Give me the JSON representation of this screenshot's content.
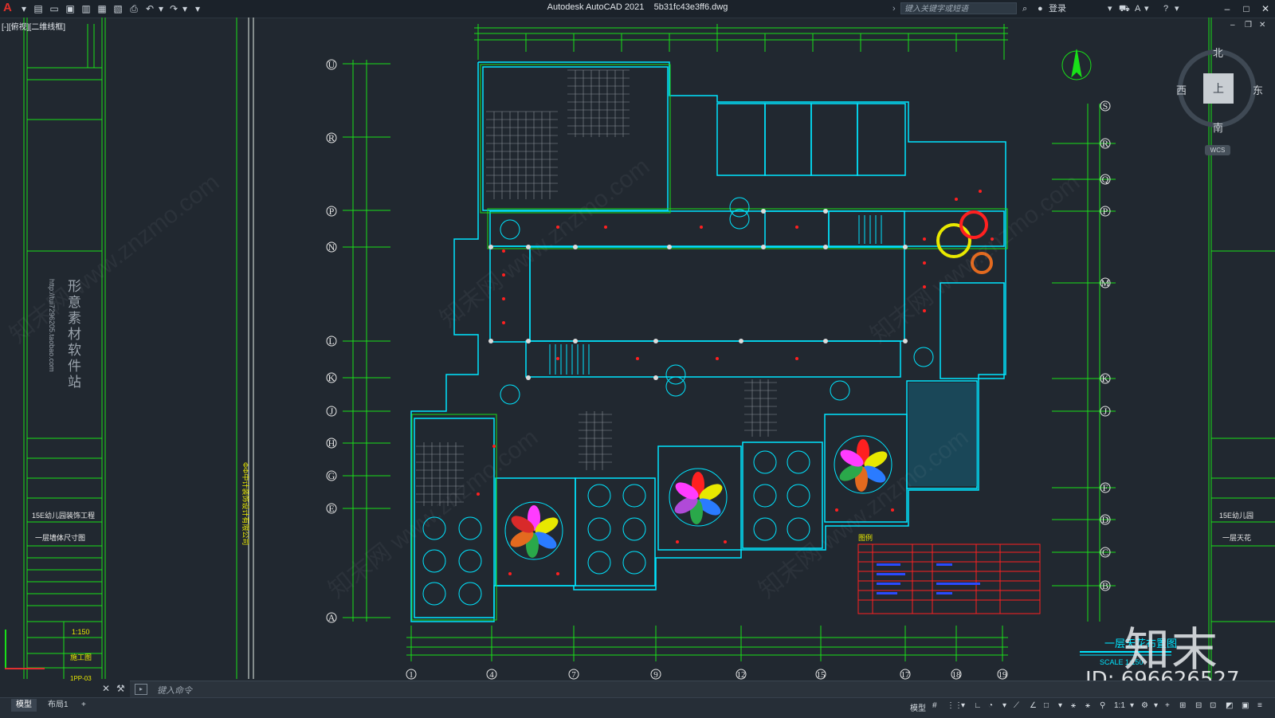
{
  "window": {
    "app_title": "Autodesk AutoCAD 2021",
    "file_name": "5b31fc43e3ff6.dwg",
    "search_placeholder": "键入关键字或短语",
    "login_label": "登录"
  },
  "viewport": {
    "label": "[-][俯视][二维线框]"
  },
  "viewcube": {
    "north": "北",
    "south": "南",
    "east": "东",
    "west": "西",
    "face": "上",
    "wcs": "WCS"
  },
  "command": {
    "placeholder": "键入命令"
  },
  "layouts": {
    "tabs": [
      "模型",
      "布局1"
    ],
    "add_label": "+"
  },
  "status": {
    "model_label": "模型",
    "scale_label": "1:1"
  },
  "titleblock": {
    "project_name": "15E幼儿园装饰工程",
    "drawing_name": "一层墙体尺寸图",
    "scale": "1:150",
    "stage": "施工图",
    "drawing_no": "1PP-03",
    "vertical_text": "形意素材软件站",
    "url_text": "http://tui7296205.taobao.com",
    "company_vertical": "ΦΦ中计装饰设计有限公司"
  },
  "titleblock_right": {
    "project_name": "15E幼儿园",
    "drawing_name": "一层天花"
  },
  "grid_rows": [
    "U",
    "R",
    "P",
    "N",
    "L",
    "K",
    "J",
    "H",
    "G",
    "E",
    "A"
  ],
  "grid_rows_right": [
    "S",
    "R",
    "Q",
    "P",
    "M",
    "K",
    "J",
    "F",
    "D",
    "C",
    "B"
  ],
  "grid_cols": [
    "1",
    "4",
    "7",
    "9",
    "12",
    "15",
    "17",
    "18",
    "19"
  ],
  "plan": {
    "title": "一层天花布置图",
    "scale_note": "SCALE  1:150",
    "legend_title": "图例"
  },
  "watermark": {
    "brand": "知末",
    "id": "ID: 696626527",
    "site": "知末网 www.znzmo.com"
  },
  "colors": {
    "background": "#212830",
    "wall": "#00e5ff",
    "dimension": "#19e019",
    "accent_red": "#ff2020",
    "accent_yellow": "#e8e800",
    "accent_magenta": "#ff3cff"
  }
}
